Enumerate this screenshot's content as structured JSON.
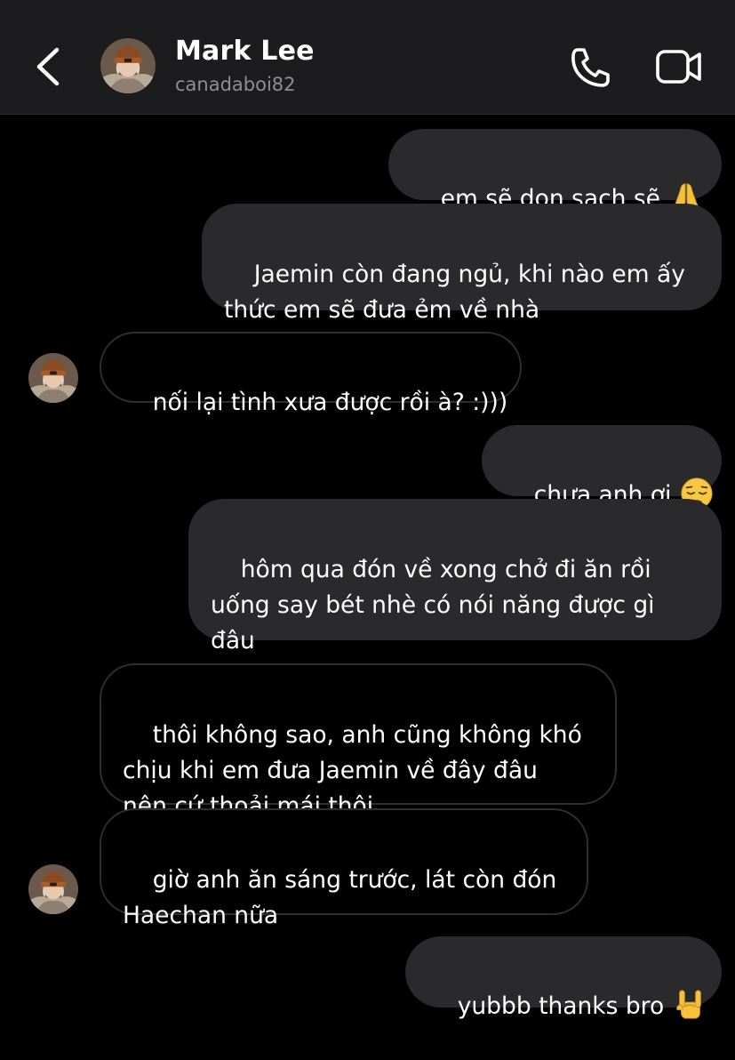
{
  "header": {
    "contact_name": "Mark Lee",
    "contact_handle": "canadaboi82",
    "back_icon": "chevron-left-icon",
    "call_icon": "phone-icon",
    "video_icon": "video-camera-icon"
  },
  "colors": {
    "background": "#000000",
    "header_background": "#1c1c1e",
    "outgoing_bubble": "#2a2a2c",
    "incoming_bubble_border": "#2e2e30",
    "secondary_text": "#8e8e93"
  },
  "messages": [
    {
      "sender": "me",
      "text": "em sẽ dọn sạch sẽ",
      "emoji": "folded-hands-emoji"
    },
    {
      "sender": "me",
      "text": "Jaemin còn đang ngủ, khi nào em ấy\nthức em sẽ đưa ẻm về nhà"
    },
    {
      "sender": "Mark Lee",
      "text": "nối lại tình xưa được rồi à? :)))"
    },
    {
      "sender": "me",
      "text": "chưa anh ơi",
      "emoji": "pensive-face-emoji"
    },
    {
      "sender": "me",
      "text": "hôm qua đón về xong chở đi ăn rồi\nuống say bét nhè có nói năng được gì\nđâu"
    },
    {
      "sender": "Mark Lee",
      "text": "thôi không sao, anh cũng không khó\nchịu khi em đưa Jaemin về đây đâu\nnên cứ thoải mái thôi"
    },
    {
      "sender": "Mark Lee",
      "text": "giờ anh ăn sáng trước, lát còn đón\nHaechan nữa"
    },
    {
      "sender": "me",
      "text": "yubbb thanks bro",
      "emoji": "sign-of-horns-emoji"
    }
  ]
}
